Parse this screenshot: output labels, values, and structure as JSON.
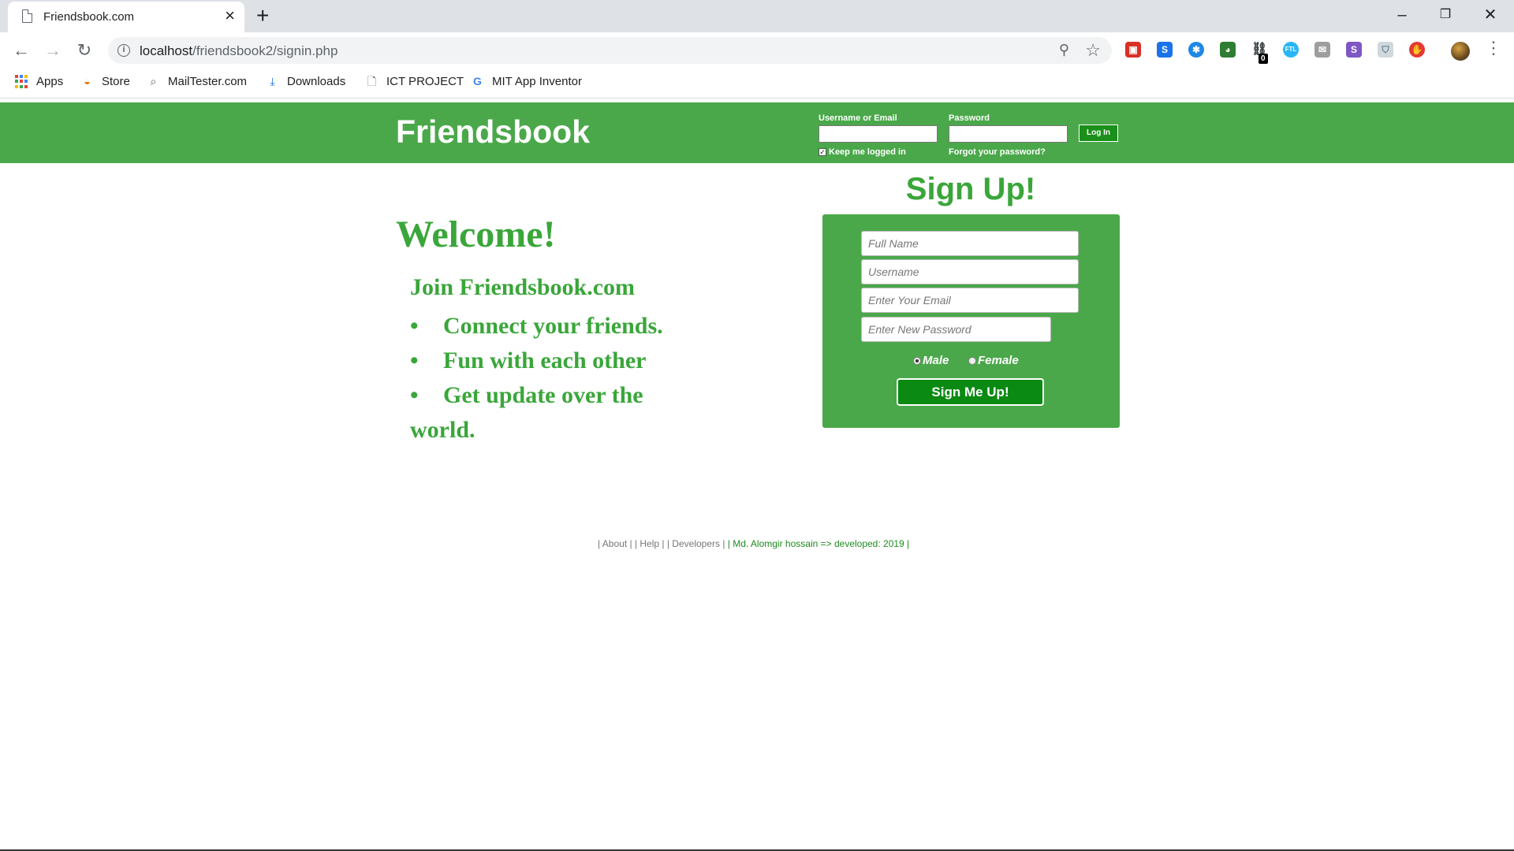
{
  "browser": {
    "tab_title": "Friendsbook.com",
    "url_host": "localhost",
    "url_path": "/friendsbook2/signin.php",
    "extension_badge": "0",
    "bookmarks": [
      "Apps",
      "Store",
      "MailTester.com",
      "Downloads",
      "ICT PROJECT",
      "MIT App Inventor"
    ]
  },
  "header": {
    "logo": "Friendsbook",
    "username_label": "Username or Email",
    "password_label": "Password",
    "login_button": "Log In",
    "keep_logged_in": "Keep me logged in",
    "forgot_password": "Forgot your password?"
  },
  "intro": {
    "welcome": "Welcome!",
    "join": "Join Friendsbook.com",
    "features": [
      "Connect your friends.",
      "Fun with each other",
      "Get update over the world."
    ]
  },
  "signup": {
    "title": "Sign Up!",
    "full_name_placeholder": "Full Name",
    "username_placeholder": "Username",
    "email_placeholder": "Enter Your Email",
    "password_placeholder": "Enter New Password",
    "male_label": "Male",
    "female_label": "Female",
    "submit_label": "Sign Me Up!"
  },
  "footer": {
    "links": "| About | | Help | | Developers |",
    "credit": " | Md. Alomgir hossain => developed: 2019 |"
  },
  "colors": {
    "brand_green": "#4aa84a",
    "text_green": "#3aa63a",
    "button_green": "#0a8a12"
  }
}
